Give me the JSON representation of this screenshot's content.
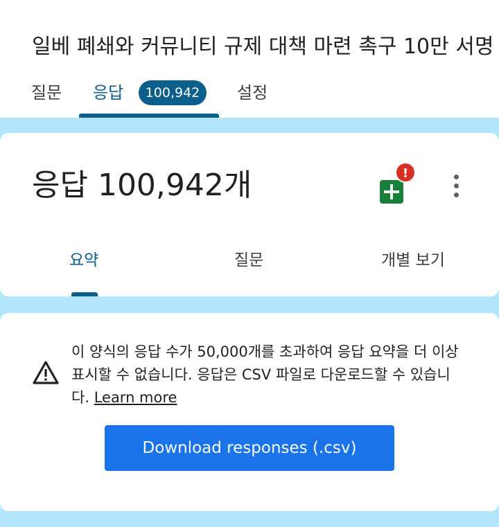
{
  "header": {
    "title": "일베 폐쇄와 커뮤니티 규제 대책 마련 촉구 10만 서명",
    "tabs": {
      "questions": "질문",
      "responses": "응답",
      "responses_count": "100,942",
      "settings": "설정"
    }
  },
  "summary": {
    "title": "응답 100,942개",
    "sheets_alert": "!",
    "sub_tabs": {
      "summary": "요약",
      "question": "질문",
      "individual": "개별 보기"
    }
  },
  "notice": {
    "text": "이 양식의 응답 수가 50,000개를 초과하여 응답 요약을 더 이상 표시할 수 없습니다. 응답은 CSV 파일로 다운로드할 수 있습니다.",
    "learn_more": "Learn more",
    "download_label": "Download responses (.csv)"
  },
  "colors": {
    "accent": "#0b5f8a",
    "canvas": "#b3e5fc",
    "button": "#1a73e8",
    "sheets": "#188038",
    "alert": "#d93025"
  },
  "icons": [
    "google-sheets-icon",
    "alert-badge-icon",
    "more-vert-icon",
    "warning-icon"
  ]
}
